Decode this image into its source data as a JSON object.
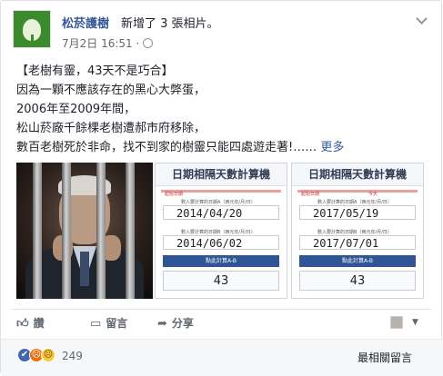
{
  "post": {
    "page_name": "松菸護樹",
    "action": "新增了 3 張相片。",
    "time": "7月2日 16:51 ·",
    "lines": [
      "【老樹有靈，43天不是巧合】",
      "因為一顆不應該存在的黑心大弊蛋，",
      "2006年至2009年間，",
      "松山菸廠千餘棵老樹遭郝市府移除，",
      "數百老樹死於非命，找不到家的樹靈只能四處遊走著!……"
    ],
    "see_more": "更多"
  },
  "calculators": [
    {
      "title": "日期相隔天數計算機",
      "tag_a": "起始日期",
      "tag_b": "",
      "label_a": "數入要計算的日期A（西元年/月/日）",
      "date_a": "2014/04/20",
      "label_b": "數入要計算的日期B（西元年/月/日）",
      "date_b": "2014/06/02",
      "button": "點此計算A-B",
      "result": "43"
    },
    {
      "title": "日期相隔天數計算機",
      "tag_a": "起始日期",
      "tag_b": "今天",
      "label_a": "數入要計算的日期A（西元年/月/日）",
      "date_a": "2017/05/19",
      "label_b": "數入要計算的日期B（西元年/月/日）",
      "date_b": "2017/07/01",
      "button": "點此計算A-B",
      "result": "43"
    }
  ],
  "actions": {
    "like": "讚",
    "comment": "留言",
    "share": "分享"
  },
  "icons": {
    "like": "thumbs-up-icon",
    "comment": "speech-bubble-icon",
    "share": "share-arrow-icon"
  },
  "reactions": {
    "count": "249",
    "sort": "最相關留言"
  },
  "colors": {
    "link": "#365899",
    "accent": "#4267b2"
  }
}
